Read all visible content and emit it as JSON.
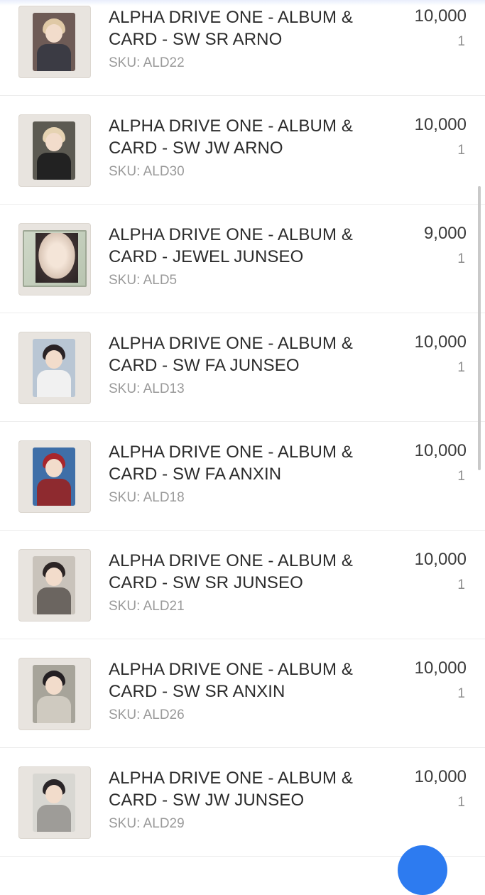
{
  "items": [
    {
      "title_line1": "ALPHA DRIVE ONE - ALBUM &",
      "title_line2": "CARD - SW SR ARNO",
      "sku": "SKU: ALD22",
      "price": "10,000",
      "qty": "1",
      "thumb_color": "#6e5b56",
      "hair_color": "#e0c9a6",
      "body_color": "#3b3b44"
    },
    {
      "title_line1": "ALPHA DRIVE ONE - ALBUM &",
      "title_line2": "CARD - SW JW ARNO",
      "sku": "SKU: ALD30",
      "price": "10,000",
      "qty": "1",
      "thumb_color": "#5c5a52",
      "hair_color": "#e6d3b2",
      "body_color": "#222222"
    },
    {
      "title_line1": "ALPHA DRIVE ONE - ALBUM &",
      "title_line2": "CARD - JEWEL JUNSEO",
      "sku": "SKU: ALD5",
      "price": "9,000",
      "qty": "1",
      "thumb_color": "#b8c4b0",
      "hair_color": "#2b2424",
      "body_color": "#cfd8c8"
    },
    {
      "title_line1": "ALPHA DRIVE ONE - ALBUM &",
      "title_line2": "CARD - SW FA JUNSEO",
      "sku": "SKU: ALD13",
      "price": "10,000",
      "qty": "1",
      "thumb_color": "#b9c6d4",
      "hair_color": "#2a2326",
      "body_color": "#f1f1f1"
    },
    {
      "title_line1": "ALPHA DRIVE ONE - ALBUM &",
      "title_line2": "CARD - SW FA ANXIN",
      "sku": "SKU: ALD18",
      "price": "10,000",
      "qty": "1",
      "thumb_color": "#3f6fa8",
      "hair_color": "#a8262c",
      "body_color": "#8e2a2f"
    },
    {
      "title_line1": "ALPHA DRIVE ONE - ALBUM &",
      "title_line2": "CARD - SW SR JUNSEO",
      "sku": "SKU: ALD21",
      "price": "10,000",
      "qty": "1",
      "thumb_color": "#c9c3bb",
      "hair_color": "#2b2424",
      "body_color": "#6b6560"
    },
    {
      "title_line1": "ALPHA DRIVE ONE - ALBUM &",
      "title_line2": "CARD - SW SR ANXIN",
      "sku": "SKU: ALD26",
      "price": "10,000",
      "qty": "1",
      "thumb_color": "#a7a49a",
      "hair_color": "#231f22",
      "body_color": "#cfcac0"
    },
    {
      "title_line1": "ALPHA DRIVE ONE - ALBUM &",
      "title_line2": "CARD - SW JW JUNSEO",
      "sku": "SKU: ALD29",
      "price": "10,000",
      "qty": "1",
      "thumb_color": "#d8d7d2",
      "hair_color": "#2a2528",
      "body_color": "#9e9c98"
    }
  ]
}
